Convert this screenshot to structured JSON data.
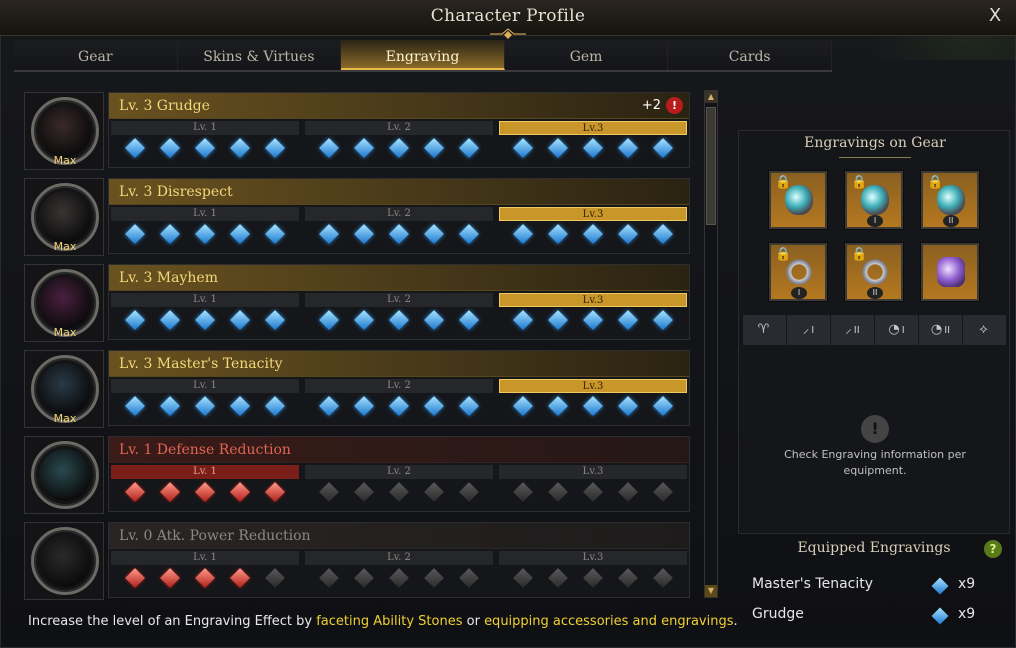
{
  "window": {
    "title": "Character Profile",
    "close_label": "X"
  },
  "tabs": [
    {
      "label": "Gear",
      "active": false
    },
    {
      "label": "Skins & Virtues",
      "active": false
    },
    {
      "label": "Engraving",
      "active": true
    },
    {
      "label": "Gem",
      "active": false
    },
    {
      "label": "Cards",
      "active": false
    }
  ],
  "engravings": [
    {
      "name": "Lv. 3 Grudge",
      "status": "max",
      "max_label": "Max",
      "bonus": "+2",
      "portrait_icon": "grudge-portrait",
      "levels": [
        {
          "label": "Lv. 1",
          "gems": 5
        },
        {
          "label": "Lv. 2",
          "gems": 5
        },
        {
          "label": "Lv.3",
          "gems": 5
        }
      ],
      "active_level": 3,
      "gem_color": "blue"
    },
    {
      "name": "Lv. 3 Disrespect",
      "status": "max",
      "max_label": "Max",
      "portrait_icon": "disrespect-portrait",
      "levels": [
        {
          "label": "Lv. 1",
          "gems": 5
        },
        {
          "label": "Lv. 2",
          "gems": 5
        },
        {
          "label": "Lv.3",
          "gems": 5
        }
      ],
      "active_level": 3,
      "gem_color": "blue"
    },
    {
      "name": "Lv. 3 Mayhem",
      "status": "max",
      "max_label": "Max",
      "portrait_icon": "mayhem-portrait",
      "levels": [
        {
          "label": "Lv. 1",
          "gems": 5
        },
        {
          "label": "Lv. 2",
          "gems": 5
        },
        {
          "label": "Lv.3",
          "gems": 5
        }
      ],
      "active_level": 3,
      "gem_color": "blue"
    },
    {
      "name": "Lv. 3 Master's Tenacity",
      "status": "max",
      "max_label": "Max",
      "portrait_icon": "masters-tenacity-portrait",
      "levels": [
        {
          "label": "Lv. 1",
          "gems": 5
        },
        {
          "label": "Lv. 2",
          "gems": 5
        },
        {
          "label": "Lv.3",
          "gems": 5
        }
      ],
      "active_level": 3,
      "gem_color": "blue"
    },
    {
      "name": "Lv. 1 Defense Reduction",
      "status": "penalty",
      "portrait_icon": "defense-reduction-portrait",
      "levels": [
        {
          "label": "Lv. 1",
          "gems": 5
        },
        {
          "label": "Lv. 2",
          "gems": 5
        },
        {
          "label": "Lv.3",
          "gems": 5
        }
      ],
      "active_level": 1,
      "filled_gems": 5,
      "gem_color": "red"
    },
    {
      "name": "Lv. 0 Atk. Power Reduction",
      "status": "inactive",
      "portrait_icon": "atk-power-reduction-portrait",
      "levels": [
        {
          "label": "Lv. 1",
          "gems": 5
        },
        {
          "label": "Lv. 2",
          "gems": 5
        },
        {
          "label": "Lv.3",
          "gems": 5
        }
      ],
      "active_level": 0,
      "filled_gems": 4,
      "gem_color": "red"
    }
  ],
  "footer": {
    "text_before": "Increase the level of an Engraving Effect by ",
    "link1": "faceting Ability Stones",
    "text_mid": " or ",
    "link2": "equipping accessories and engravings",
    "text_after": "."
  },
  "gear_panel": {
    "title": "Engravings on Gear",
    "accessories": [
      {
        "icon": "necklace-icon",
        "locked": true,
        "numeral": ""
      },
      {
        "icon": "earring-icon",
        "locked": true,
        "numeral": "I"
      },
      {
        "icon": "earring-icon",
        "locked": true,
        "numeral": "II"
      },
      {
        "icon": "ring-icon",
        "locked": true,
        "numeral": "I"
      },
      {
        "icon": "ring-icon",
        "locked": true,
        "numeral": "II"
      },
      {
        "icon": "ability-stone-icon",
        "locked": false,
        "numeral": ""
      }
    ],
    "slots": [
      {
        "icon": "necklace-slot-icon",
        "label": ""
      },
      {
        "icon": "earring-slot-icon",
        "label": "I"
      },
      {
        "icon": "earring-slot-icon",
        "label": "II"
      },
      {
        "icon": "ring-slot-icon",
        "label": "I"
      },
      {
        "icon": "ring-slot-icon",
        "label": "II"
      },
      {
        "icon": "stone-slot-icon",
        "label": ""
      }
    ],
    "info_text": "Check Engraving information per equipment."
  },
  "equipped": {
    "title": "Equipped Engravings",
    "help": "?",
    "items": [
      {
        "name": "Master's Tenacity",
        "count": "x9"
      },
      {
        "name": "Grudge",
        "count": "x9"
      }
    ]
  }
}
